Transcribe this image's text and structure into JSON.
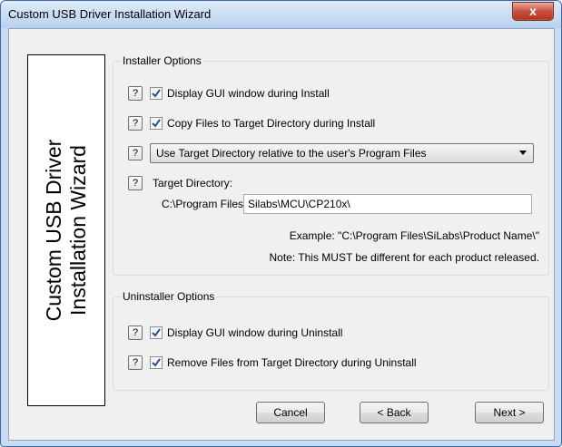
{
  "window": {
    "title": "Custom USB Driver Installation Wizard",
    "close_symbol": "x"
  },
  "sidebar": {
    "line1": "Custom USB Driver",
    "line2": "Installation Wizard"
  },
  "installer": {
    "legend": "Installer Options",
    "help_symbol": "?",
    "display_gui": {
      "label": "Display GUI window during Install",
      "checked": true
    },
    "copy_files": {
      "label": "Copy Files to Target Directory during Install",
      "checked": true
    },
    "dir_mode": {
      "selected": "Use Target Directory relative to the user's Program Files"
    },
    "target_label": "Target Directory:",
    "target_prefix": "C:\\Program Files\\",
    "target_value": "Silabs\\MCU\\CP210x\\",
    "example": "Example: \"C:\\Program Files\\SiLabs\\Product Name\\\"",
    "note": "Note: This MUST be different for each product released."
  },
  "uninstaller": {
    "legend": "Uninstaller Options",
    "display_gui": {
      "label": "Display GUI window during Uninstall",
      "checked": true
    },
    "remove_files": {
      "label": "Remove Files from Target Directory during Uninstall",
      "checked": true
    }
  },
  "buttons": {
    "cancel": "Cancel",
    "back": "< Back",
    "next": "Next >"
  },
  "colors": {
    "title_bar": "#c9dcf3",
    "close_button": "#c7503d",
    "dialog_bg": "#f0f0f0",
    "check_mark": "#2a4f8e"
  }
}
